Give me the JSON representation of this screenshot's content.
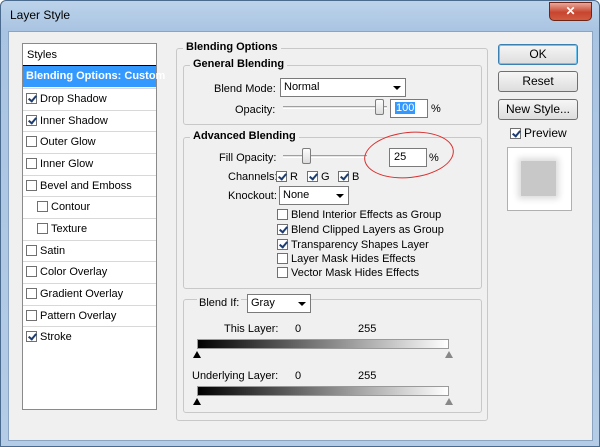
{
  "window": {
    "title": "Layer Style",
    "close_glyph": "✕"
  },
  "styles_panel": {
    "header": "Styles",
    "items": [
      {
        "label": "Blending Options: Custom",
        "checked": null,
        "selected": true
      },
      {
        "label": "Drop Shadow",
        "checked": true
      },
      {
        "label": "Inner Shadow",
        "checked": true
      },
      {
        "label": "Outer Glow",
        "checked": false
      },
      {
        "label": "Inner Glow",
        "checked": false
      },
      {
        "label": "Bevel and Emboss",
        "checked": false
      },
      {
        "label": "Contour",
        "checked": false,
        "sub": true
      },
      {
        "label": "Texture",
        "checked": false,
        "sub": true
      },
      {
        "label": "Satin",
        "checked": false
      },
      {
        "label": "Color Overlay",
        "checked": false
      },
      {
        "label": "Gradient Overlay",
        "checked": false
      },
      {
        "label": "Pattern Overlay",
        "checked": false
      },
      {
        "label": "Stroke",
        "checked": true
      }
    ]
  },
  "blending": {
    "title": "Blending Options",
    "general": {
      "title": "General Blending",
      "blend_mode_label": "Blend Mode:",
      "blend_mode_value": "Normal",
      "opacity_label": "Opacity:",
      "opacity_value": "100",
      "opacity_unit": "%"
    },
    "advanced": {
      "title": "Advanced Blending",
      "fill_opacity_label": "Fill Opacity:",
      "fill_opacity_value": "25",
      "fill_opacity_unit": "%",
      "channels_label": "Channels:",
      "channels": [
        {
          "label": "R",
          "checked": true
        },
        {
          "label": "G",
          "checked": true
        },
        {
          "label": "B",
          "checked": true
        }
      ],
      "knockout_label": "Knockout:",
      "knockout_value": "None",
      "options": [
        {
          "label": "Blend Interior Effects as Group",
          "checked": false
        },
        {
          "label": "Blend Clipped Layers as Group",
          "checked": true
        },
        {
          "label": "Transparency Shapes Layer",
          "checked": true
        },
        {
          "label": "Layer Mask Hides Effects",
          "checked": false
        },
        {
          "label": "Vector Mask Hides Effects",
          "checked": false
        }
      ]
    },
    "blend_if": {
      "label": "Blend If:",
      "value": "Gray",
      "this_layer_label": "This Layer:",
      "this_layer_min": "0",
      "this_layer_max": "255",
      "underlying_label": "Underlying Layer:",
      "underlying_min": "0",
      "underlying_max": "255"
    }
  },
  "buttons": {
    "ok": "OK",
    "reset": "Reset",
    "new_style": "New Style...",
    "preview_label": "Preview",
    "preview_checked": true
  },
  "colors": {
    "selection": "#3399ff",
    "annotation": "#d83030",
    "close": "#c7452f"
  }
}
